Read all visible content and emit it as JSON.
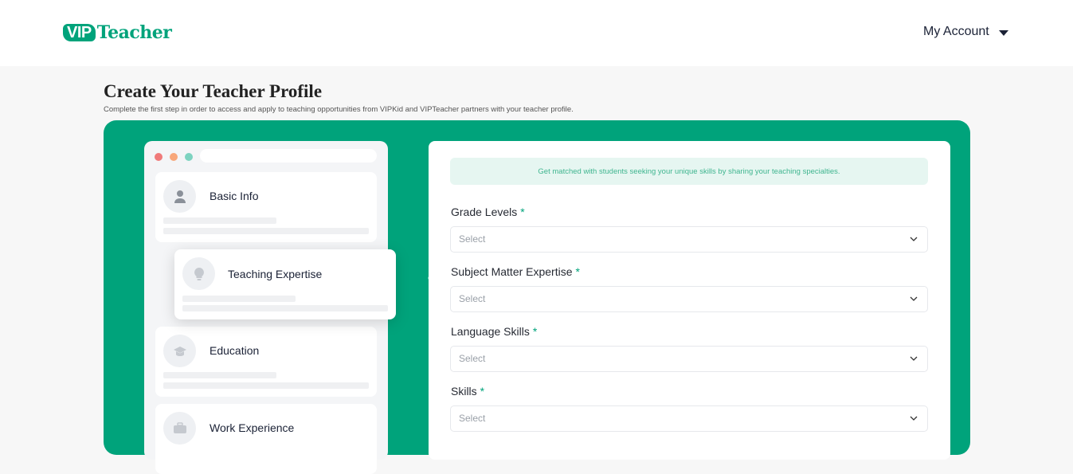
{
  "header": {
    "logo_vip": "VIP",
    "logo_teacher": "Teacher",
    "account_label": "My Account"
  },
  "page": {
    "title": "Create Your Teacher Profile",
    "subtitle": "Complete the first step in order to access and apply to teaching opportunities from VIPKid and VIPTeacher partners with your teacher profile."
  },
  "colors": {
    "brand": "#00a37b",
    "dot_red": "#f07a7a",
    "dot_orange": "#f8a77a",
    "dot_teal": "#7dd3c0"
  },
  "steps": [
    {
      "label": "Basic Info",
      "icon": "user-icon",
      "active": false
    },
    {
      "label": "Teaching Expertise",
      "icon": "lightbulb-icon",
      "active": true
    },
    {
      "label": "Education",
      "icon": "graduation-cap-icon",
      "active": false
    },
    {
      "label": "Work Experience",
      "icon": "briefcase-icon",
      "active": false
    }
  ],
  "form": {
    "banner": "Get matched with students seeking your unique skills by sharing your teaching specialties.",
    "fields": [
      {
        "label": "Grade Levels",
        "required": "*",
        "placeholder": "Select"
      },
      {
        "label": "Subject Matter Expertise",
        "required": "*",
        "placeholder": "Select"
      },
      {
        "label": "Language Skills",
        "required": "*",
        "placeholder": "Select"
      },
      {
        "label": "Skills",
        "required": "*",
        "placeholder": "Select"
      }
    ]
  }
}
